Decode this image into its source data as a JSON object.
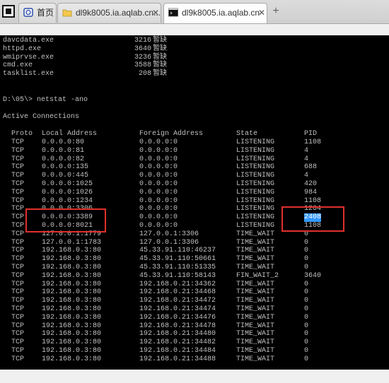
{
  "tabs": [
    {
      "label": "首页",
      "icon": "home-tab-icon"
    },
    {
      "label": "dl9k8005.ia.aqlab.cn...",
      "icon": "folder-icon"
    },
    {
      "label": "dl9k8005.ia.aqlab.cn",
      "icon": "terminal-icon"
    }
  ],
  "tab_close": "✕",
  "new_tab": "+",
  "process_list": [
    {
      "name": "davcdata.exe",
      "pid": "3216",
      "status": "暂缺"
    },
    {
      "name": "httpd.exe",
      "pid": "3640",
      "status": "暂缺"
    },
    {
      "name": "wmiprvse.exe",
      "pid": "3236",
      "status": "暂缺"
    },
    {
      "name": "cmd.exe",
      "pid": "3588",
      "status": "暂缺"
    },
    {
      "name": "tasklist.exe",
      "pid": "208",
      "status": "暂缺"
    }
  ],
  "prompt": "D:\\05\\> netstat -ano",
  "section_title": "Active Connections",
  "columns": [
    "Proto",
    "Local Address",
    "Foreign Address",
    "State",
    "PID"
  ],
  "connections": [
    [
      "TCP",
      "0.0.0.0:80",
      "0.0.0.0:0",
      "LISTENING",
      "1108"
    ],
    [
      "TCP",
      "0.0.0.0:81",
      "0.0.0.0:0",
      "LISTENING",
      "4"
    ],
    [
      "TCP",
      "0.0.0.0:82",
      "0.0.0.0:0",
      "LISTENING",
      "4"
    ],
    [
      "TCP",
      "0.0.0.0:135",
      "0.0.0.0:0",
      "LISTENING",
      "688"
    ],
    [
      "TCP",
      "0.0.0.0:445",
      "0.0.0.0:0",
      "LISTENING",
      "4"
    ],
    [
      "TCP",
      "0.0.0.0:1025",
      "0.0.0.0:0",
      "LISTENING",
      "420"
    ],
    [
      "TCP",
      "0.0.0.0:1026",
      "0.0.0.0:0",
      "LISTENING",
      "984"
    ],
    [
      "TCP",
      "0.0.0.0:1234",
      "0.0.0.0:0",
      "LISTENING",
      "1108"
    ],
    [
      "TCP",
      "0.0.0.0:3306",
      "0.0.0.0:0",
      "LISTENING",
      "1264"
    ],
    [
      "TCP",
      "0.0.0.0:3389",
      "0.0.0.0:0",
      "LISTENING",
      "2408"
    ],
    [
      "TCP",
      "0.0.0.0:8021",
      "0.0.0.0:0",
      "LISTENING",
      "1108"
    ],
    [
      "TCP",
      "127.0.0.1:1779",
      "127.0.0.1:3306",
      "TIME_WAIT",
      "0"
    ],
    [
      "TCP",
      "127.0.0.1:1783",
      "127.0.0.1:3306",
      "TIME_WAIT",
      "0"
    ],
    [
      "TCP",
      "192.168.0.3:80",
      "45.33.91.110:46237",
      "TIME_WAIT",
      "0"
    ],
    [
      "TCP",
      "192.168.0.3:80",
      "45.33.91.110:50661",
      "TIME_WAIT",
      "0"
    ],
    [
      "TCP",
      "192.168.0.3:80",
      "45.33.91.110:51335",
      "TIME_WAIT",
      "0"
    ],
    [
      "TCP",
      "192.168.0.3:80",
      "45.33.91.110:58143",
      "FIN_WAIT_2",
      "3640"
    ],
    [
      "TCP",
      "192.168.0.3:80",
      "192.168.0.21:34362",
      "TIME_WAIT",
      "0"
    ],
    [
      "TCP",
      "192.168.0.3:80",
      "192.168.0.21:34468",
      "TIME_WAIT",
      "0"
    ],
    [
      "TCP",
      "192.168.0.3:80",
      "192.168.0.21:34472",
      "TIME_WAIT",
      "0"
    ],
    [
      "TCP",
      "192.168.0.3:80",
      "192.168.0.21:34474",
      "TIME_WAIT",
      "0"
    ],
    [
      "TCP",
      "192.168.0.3:80",
      "192.168.0.21:34476",
      "TIME_WAIT",
      "0"
    ],
    [
      "TCP",
      "192.168.0.3:80",
      "192.168.0.21:34478",
      "TIME_WAIT",
      "0"
    ],
    [
      "TCP",
      "192.168.0.3:80",
      "192.168.0.21:34480",
      "TIME_WAIT",
      "0"
    ],
    [
      "TCP",
      "192.168.0.3:80",
      "192.168.0.21:34482",
      "TIME_WAIT",
      "0"
    ],
    [
      "TCP",
      "192.168.0.3:80",
      "192.168.0.21:34484",
      "TIME_WAIT",
      "0"
    ],
    [
      "TCP",
      "192.168.0.3:80",
      "192.168.0.21:34488",
      "TIME_WAIT",
      "0"
    ]
  ],
  "selected_pid": "2408",
  "colors": {
    "console_bg": "#000000",
    "console_text": "#c0c0c0",
    "selection": "#3399ff",
    "annotation_box": "#e0302c"
  }
}
